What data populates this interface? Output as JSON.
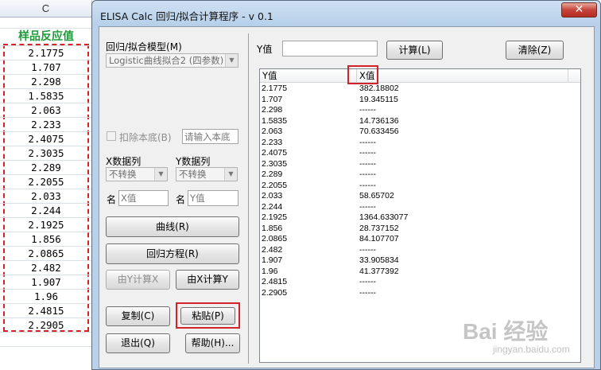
{
  "sheet": {
    "column_header": "C",
    "header_cell": "样品反应值",
    "values": [
      "2.1775",
      "1.707",
      "2.298",
      "1.5835",
      "2.063",
      "2.233",
      "2.4075",
      "2.3035",
      "2.289",
      "2.2055",
      "2.033",
      "2.244",
      "2.1925",
      "1.856",
      "2.0865",
      "2.482",
      "1.907",
      "1.96",
      "2.4815",
      "2.2905"
    ]
  },
  "dialog": {
    "title": "ELISA Calc 回归/拟合计算程序 - v 0.1",
    "close_glyph": "✕",
    "model_label": "回归/拟合模型(M)",
    "model_value": "Logistic曲线拟合2 (四参数)",
    "y_value_label": "Y值",
    "y_value_input": "",
    "compute_button": "计算(L)",
    "clear_button": "清除(Z)",
    "deduct_label": "扣除本底(B)",
    "background_placeholder": "请输入本底",
    "x_col_label": "X数据列",
    "y_col_label": "Y数据列",
    "x_transform": "不转换",
    "y_transform": "不转换",
    "name_label_x": "名",
    "name_label_y": "名",
    "x_name_value": "X值",
    "y_name_value": "Y值",
    "curve_button": "曲线(R)",
    "regression_button": "回归方程(R)",
    "calc_x_button": "由Y计算X",
    "calc_y_button": "由X计算Y",
    "copy_button": "复制(C)",
    "paste_button": "粘贴(P)",
    "exit_button": "退出(Q)",
    "help_button": "帮助(H)..."
  },
  "result_table": {
    "columns": [
      "Y值",
      "X值"
    ],
    "rows": [
      [
        "2.1775",
        "382.18802"
      ],
      [
        "1.707",
        "19.345115"
      ],
      [
        "2.298",
        "------"
      ],
      [
        "1.5835",
        "14.736136"
      ],
      [
        "2.063",
        "70.633456"
      ],
      [
        "2.233",
        "------"
      ],
      [
        "2.4075",
        "------"
      ],
      [
        "2.3035",
        "------"
      ],
      [
        "2.289",
        "------"
      ],
      [
        "2.2055",
        "------"
      ],
      [
        "2.033",
        "58.65702"
      ],
      [
        "2.244",
        "------"
      ],
      [
        "2.1925",
        "1364.633077"
      ],
      [
        "1.856",
        "28.737152"
      ],
      [
        "2.0865",
        "84.107707"
      ],
      [
        "2.482",
        "------"
      ],
      [
        "1.907",
        "33.905834"
      ],
      [
        "1.96",
        "41.377392"
      ],
      [
        "2.4815",
        "------"
      ],
      [
        "2.2905",
        "------"
      ]
    ]
  },
  "watermark": {
    "brand": "Bai 经验",
    "url": "jingyan.baidu.com"
  },
  "colors": {
    "highlight_red": "#d2232a",
    "header_green": "#1e9b3a",
    "dialog_frame": "#b9d1ea"
  }
}
